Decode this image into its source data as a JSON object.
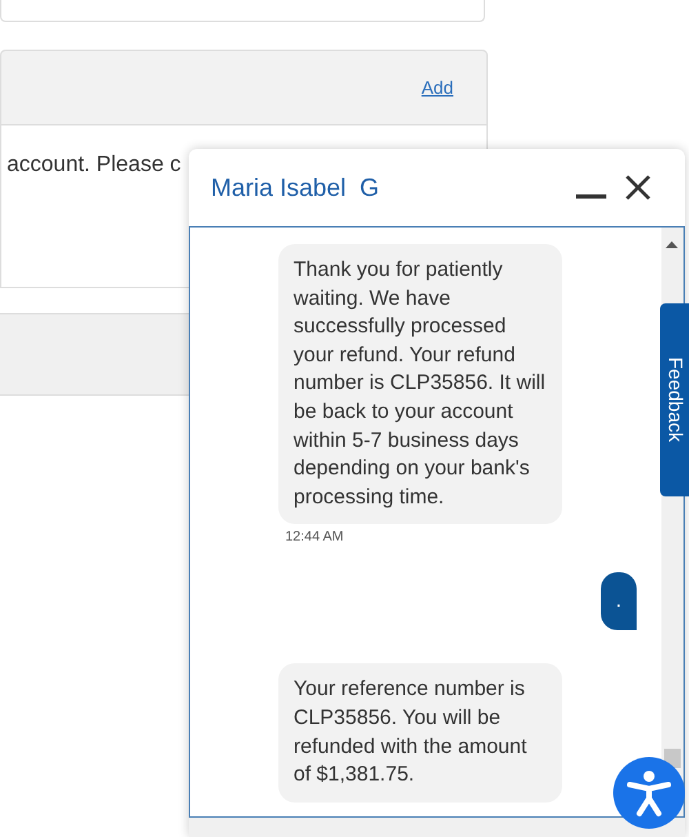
{
  "page": {
    "add_link": "Add",
    "notice_text": "account. Please c"
  },
  "chat": {
    "agent_name": "Maria Isabel  G",
    "messages": [
      {
        "kind": "agent",
        "text": "Thank you for patiently waiting. We have successfully processed your refund. Your refund number is CLP35856. It will be back to your account within 5-7 business days depending on your bank's processing time.",
        "time": "12:44 AM"
      },
      {
        "kind": "user",
        "text": "."
      },
      {
        "kind": "agent",
        "text": "Your reference number is CLP35856. You will be refunded with the amount of $1,381.75."
      }
    ]
  },
  "feedback_tab": "Feedback"
}
